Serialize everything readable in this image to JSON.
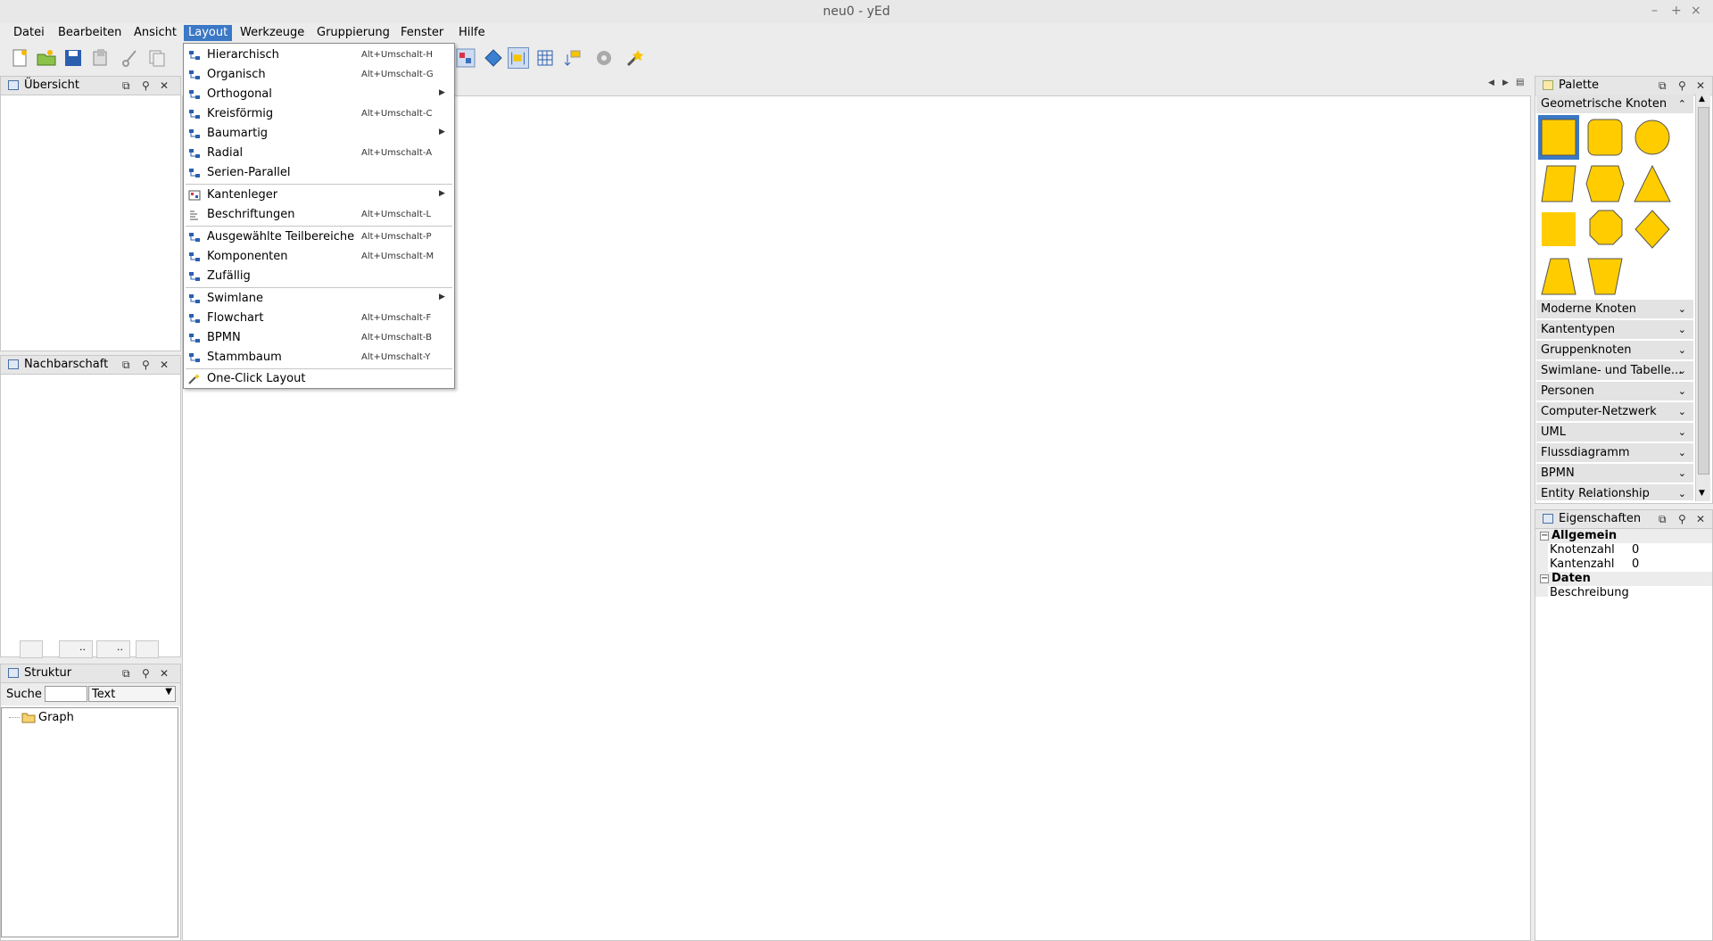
{
  "window": {
    "title": "neu0 - yEd",
    "minimize": "–",
    "maximize": "+",
    "close": "×"
  },
  "menubar": [
    "Datei",
    "Bearbeiten",
    "Ansicht",
    "Layout",
    "Werkzeuge",
    "Gruppierung",
    "Fenster",
    "Hilfe"
  ],
  "layout_menu": [
    {
      "label": "Hierarchisch",
      "shortcut": "Alt+Umschalt-H",
      "submenu": false
    },
    {
      "label": "Organisch",
      "shortcut": "Alt+Umschalt-G",
      "submenu": false
    },
    {
      "label": "Orthogonal",
      "shortcut": "",
      "submenu": true
    },
    {
      "label": "Kreisförmig",
      "shortcut": "Alt+Umschalt-C",
      "submenu": false
    },
    {
      "label": "Baumartig",
      "shortcut": "",
      "submenu": true
    },
    {
      "label": "Radial",
      "shortcut": "Alt+Umschalt-A",
      "submenu": false
    },
    {
      "label": "Serien-Parallel",
      "shortcut": "",
      "submenu": false
    },
    {
      "label": "Kantenleger",
      "shortcut": "",
      "submenu": true
    },
    {
      "label": "Beschriftungen",
      "shortcut": "Alt+Umschalt-L",
      "submenu": false
    },
    {
      "label": "Ausgewählte Teilbereiche",
      "shortcut": "Alt+Umschalt-P",
      "submenu": false
    },
    {
      "label": "Komponenten",
      "shortcut": "Alt+Umschalt-M",
      "submenu": false
    },
    {
      "label": "Zufällig",
      "shortcut": "",
      "submenu": false
    },
    {
      "label": "Swimlane",
      "shortcut": "",
      "submenu": true
    },
    {
      "label": "Flowchart",
      "shortcut": "Alt+Umschalt-F",
      "submenu": false
    },
    {
      "label": "BPMN",
      "shortcut": "Alt+Umschalt-B",
      "submenu": false
    },
    {
      "label": "Stammbaum",
      "shortcut": "Alt+Umschalt-Y",
      "submenu": false
    },
    {
      "label": "One-Click Layout",
      "shortcut": "",
      "submenu": false
    }
  ],
  "panels": {
    "overview": "Übersicht",
    "neighborhood": "Nachbarschaft",
    "structure": "Struktur",
    "palette": "Palette",
    "properties": "Eigenschaften"
  },
  "structure": {
    "search_label": "Suche",
    "search_value": "",
    "mode": "Text",
    "tree_root": "Graph"
  },
  "neighborhood_tabs": [
    "",
    "..",
    "..",
    ""
  ],
  "palette": {
    "open_section": "Geometrische Knoten",
    "sections": [
      "Moderne Knoten",
      "Kantentypen",
      "Gruppenknoten",
      "Swimlane- und Tabelle...",
      "Personen",
      "Computer-Netzwerk",
      "UML",
      "Flussdiagramm",
      "BPMN",
      "Entity Relationship"
    ],
    "node_color": "#ffcc00"
  },
  "properties": {
    "group_general": "Allgemein",
    "rows": [
      {
        "name": "Knotenzahl",
        "value": "0"
      },
      {
        "name": "Kantenzahl",
        "value": "0"
      }
    ],
    "group_data": "Daten",
    "data_rows": [
      {
        "name": "Beschreibung",
        "value": ""
      }
    ]
  },
  "colors": {
    "accent": "#3b78c5",
    "node": "#ffcc00"
  }
}
